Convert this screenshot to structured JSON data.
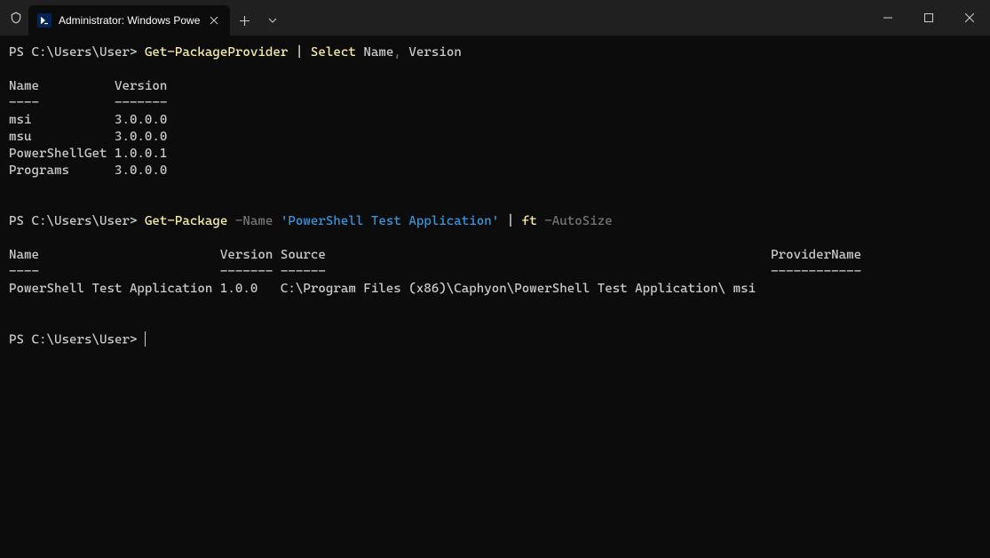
{
  "window": {
    "tab_title": "Administrator: Windows Powe"
  },
  "terminal": {
    "prompt": "PS C:\\Users\\User>",
    "cmd1": {
      "c1": "Get-PackageProvider",
      "pipe": " | ",
      "c2": "Select",
      "args": " Name",
      "comma": ",",
      "arg2": " Version"
    },
    "table1": {
      "header": "Name          Version",
      "divider": "----          -------",
      "row1": "msi           3.0.0.0",
      "row2": "msu           3.0.0.0",
      "row3": "PowerShellGet 1.0.0.1",
      "row4": "Programs      3.0.0.0"
    },
    "cmd2": {
      "c1": "Get-Package",
      "param": " -Name",
      "value": " 'PowerShell Test Application'",
      "pipe": " | ",
      "c2": "ft",
      "param2": " -AutoSize"
    },
    "table2": {
      "header": "Name                        Version Source                                                           ProviderName",
      "divider": "----                        ------- ------                                                           ------------",
      "row1": "PowerShell Test Application 1.0.0   C:\\Program Files (x86)\\Caphyon\\PowerShell Test Application\\ msi"
    }
  }
}
